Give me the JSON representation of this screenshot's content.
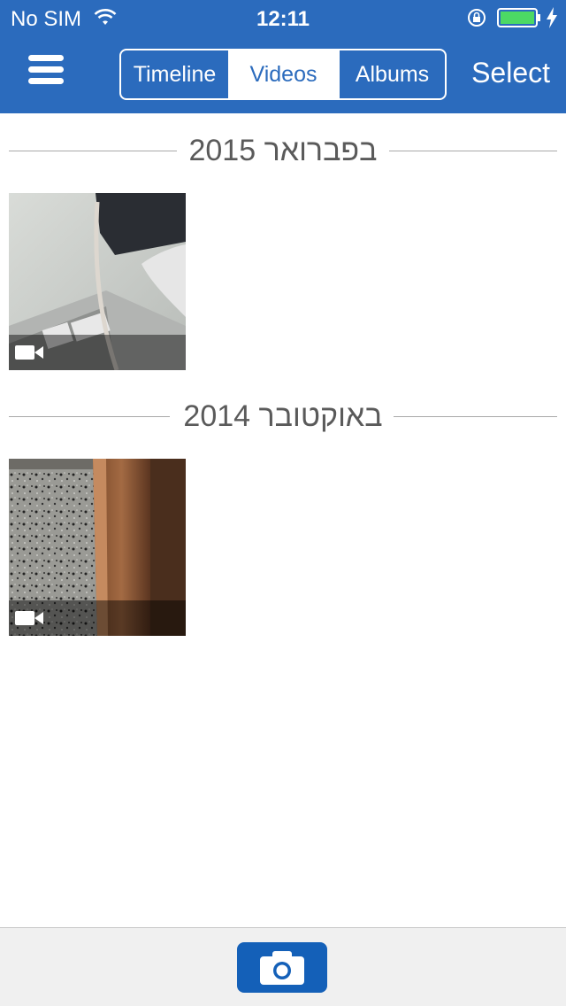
{
  "status_bar": {
    "carrier": "No SIM",
    "time": "12:11",
    "icons": [
      "wifi-icon",
      "lock-rotation-icon",
      "battery-icon",
      "charging-icon"
    ]
  },
  "navbar": {
    "menu_icon": "hamburger-menu-icon",
    "tabs": [
      {
        "label": "Timeline",
        "selected": false
      },
      {
        "label": "Videos",
        "selected": true
      },
      {
        "label": "Albums",
        "selected": false
      }
    ],
    "select_label": "Select"
  },
  "sections": [
    {
      "title": "בפברואר 2015",
      "items": [
        {
          "type": "video",
          "icon": "video-camera-icon"
        }
      ]
    },
    {
      "title": "באוקטובר 2014",
      "items": [
        {
          "type": "video",
          "icon": "video-camera-icon"
        }
      ]
    }
  ],
  "bottom_bar": {
    "camera_icon": "camera-icon"
  },
  "colors": {
    "accent": "#2b6bbd",
    "camera_button": "#1460b8"
  }
}
